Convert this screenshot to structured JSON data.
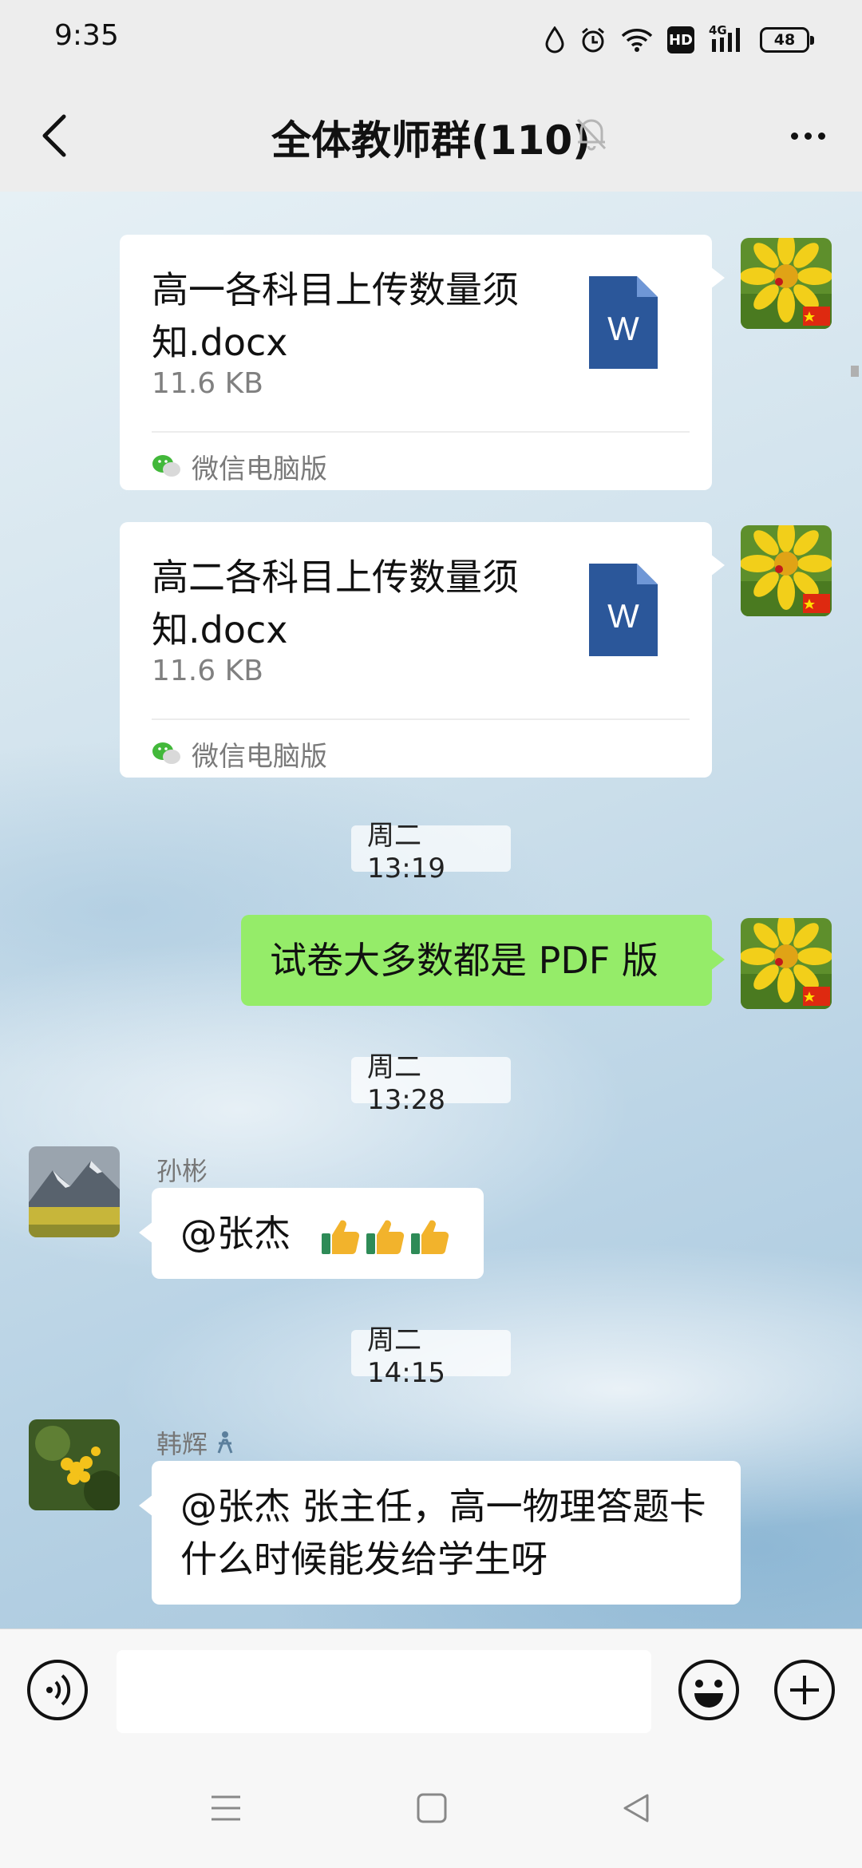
{
  "status_bar": {
    "time": "9:35",
    "network": "4G",
    "hd_label": "HD",
    "battery": "48"
  },
  "header": {
    "title": "全体教师群(110)",
    "muted": true
  },
  "messages": {
    "file1": {
      "name": "高一各科目上传数量须知.docx",
      "size": "11.6 KB",
      "source": "微信电脑版",
      "icon": "word-doc-icon",
      "icon_letter": "W"
    },
    "file2": {
      "name": "高二各科目上传数量须知.docx",
      "size": "11.6 KB",
      "source": "微信电脑版",
      "icon": "word-doc-icon",
      "icon_letter": "W"
    },
    "time1": "周二 13:19",
    "text_me": "试卷大多数都是 PDF 版",
    "time2": "周二 13:28",
    "msg_sun": {
      "sender": "孙彬",
      "text": "@张杰",
      "emoji": "thumbs-up x3"
    },
    "time3": "周二 14:15",
    "msg_han": {
      "sender": "韩辉",
      "text": "@张杰  张主任，高一物理答题卡什么时候能发给学生呀"
    }
  },
  "input_bar": {
    "placeholder": ""
  },
  "colors": {
    "my_bubble": "#95ec69",
    "word_blue": "#2b579a",
    "background": "#ededed"
  }
}
